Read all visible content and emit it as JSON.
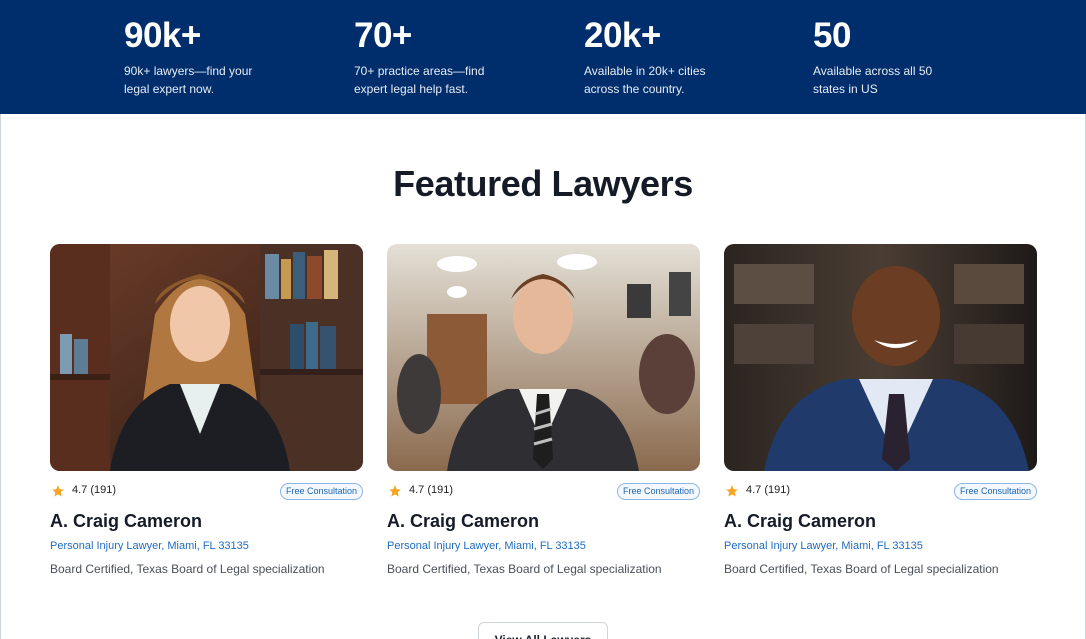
{
  "stats": [
    {
      "value": "90k+",
      "desc": "90k+ lawyers—find your legal expert now."
    },
    {
      "value": "70+",
      "desc": "70+ practice areas—find expert legal help fast."
    },
    {
      "value": "20k+",
      "desc": "Available in 20k+ cities across the country."
    },
    {
      "value": "50",
      "desc": "Available across all 50 states in US"
    }
  ],
  "section": {
    "title": "Featured Lawyers"
  },
  "lawyers": [
    {
      "rating": "4.7 (191)",
      "badge": "Free Consultation",
      "name": "A. Craig Cameron",
      "specialty": "Personal Injury Lawyer, Miami, FL 33135",
      "cert": "Board Certified, Texas Board of Legal specialization"
    },
    {
      "rating": "4.7 (191)",
      "badge": "Free Consultation",
      "name": "A. Craig Cameron",
      "specialty": "Personal Injury Lawyer, Miami, FL 33135",
      "cert": "Board Certified, Texas Board of Legal specialization"
    },
    {
      "rating": "4.7 (191)",
      "badge": "Free Consultation",
      "name": "A. Craig Cameron",
      "specialty": "Personal Injury Lawyer, Miami, FL 33135",
      "cert": "Board Certified, Texas Board of Legal specialization"
    }
  ],
  "footer": {
    "view_all_label": "View All Lawyers"
  },
  "colors": {
    "band": "#002d6b",
    "accent": "#1f6cc0",
    "star": "#f5a623"
  },
  "icons": {
    "rating": "star-icon"
  }
}
